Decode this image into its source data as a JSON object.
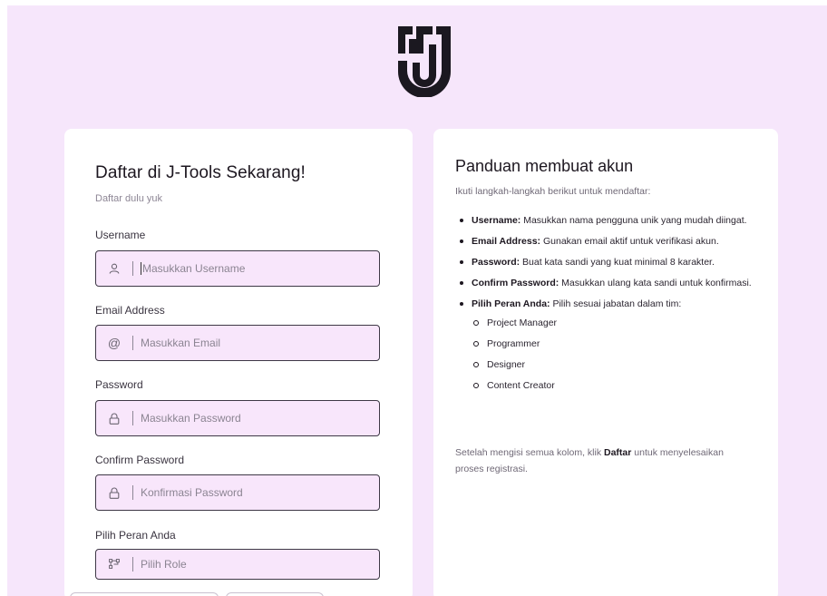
{
  "brand": {
    "logo_icon": "j-tools-logo-icon"
  },
  "form": {
    "title": "Daftar di J-Tools Sekarang!",
    "subtitle": "Daftar dulu yuk",
    "fields": [
      {
        "label": "Username",
        "placeholder": "Masukkan Username",
        "icon": "user-icon"
      },
      {
        "label": "Email Address",
        "placeholder": "Masukkan Email",
        "icon": "at-icon"
      },
      {
        "label": "Password",
        "placeholder": "Masukkan Password",
        "icon": "lock-icon"
      },
      {
        "label": "Confirm Password",
        "placeholder": "Konfirmasi Password",
        "icon": "lock-icon"
      },
      {
        "label": "Pilih Peran Anda",
        "placeholder": "Pilih Role",
        "icon": "role-icon"
      }
    ]
  },
  "guide": {
    "title": "Panduan membuat akun",
    "intro": "Ikuti langkah-langkah berikut untuk mendaftar:",
    "items": [
      {
        "term": "Username:",
        "text": " Masukkan nama pengguna unik yang mudah diingat."
      },
      {
        "term": "Email Address:",
        "text": " Gunakan email aktif untuk verifikasi akun."
      },
      {
        "term": "Password:",
        "text": " Buat kata sandi yang kuat minimal 8 karakter."
      },
      {
        "term": "Confirm Password:",
        "text": " Masukkan ulang kata sandi untuk konfirmasi."
      },
      {
        "term": "Pilih Peran Anda:",
        "text": " Pilih sesuai jabatan dalam tim:"
      }
    ],
    "roles": [
      "Project Manager",
      "Programmer",
      "Designer",
      "Content Creator"
    ],
    "outro_before": "Setelah mengisi semua kolom, klik ",
    "outro_bold": "Daftar",
    "outro_after": " untuk menyelesaikan proses registrasi."
  },
  "colors": {
    "page_background": "#f6e6fb",
    "card_background": "#ffffff",
    "field_background": "#f8e6fb",
    "field_border": "#3e3846",
    "text_primary": "#1d1720",
    "text_muted": "#8d8695"
  }
}
